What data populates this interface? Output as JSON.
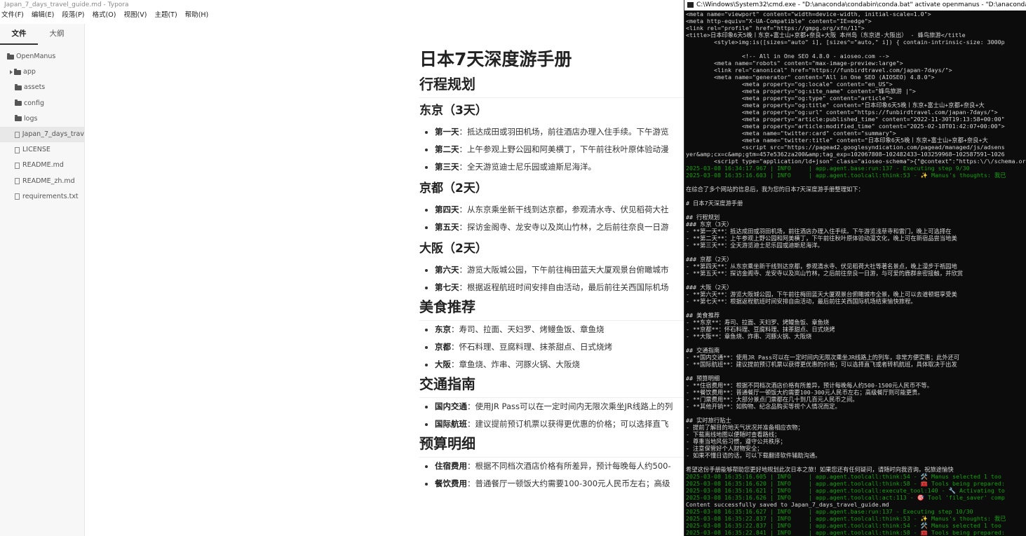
{
  "typora": {
    "title": "Japan_7_days_travel_guide.md - Typora",
    "menu": [
      "文件(F)",
      "编辑(E)",
      "段落(P)",
      "格式(O)",
      "视图(V)",
      "主题(T)",
      "帮助(H)"
    ],
    "sidebar_tabs": [
      "文件",
      "大纲"
    ],
    "tree": [
      {
        "label": "OpenManus",
        "type": "folder"
      },
      {
        "label": "app",
        "type": "folder-collapsed"
      },
      {
        "label": "assets",
        "type": "folder"
      },
      {
        "label": "config",
        "type": "folder"
      },
      {
        "label": "logs",
        "type": "folder"
      },
      {
        "label": "Japan_7_days_trav",
        "type": "file"
      },
      {
        "label": "LICENSE",
        "type": "file"
      },
      {
        "label": "README.md",
        "type": "file"
      },
      {
        "label": "README_zh.md",
        "type": "file"
      },
      {
        "label": "requirements.txt",
        "type": "file"
      }
    ],
    "doc": {
      "h1": "日本7天深度游手册",
      "itinerary_h": "行程规划",
      "tokyo_h": "东京（3天）",
      "tokyo": [
        {
          "k": "第一天",
          "v": "：抵达成田或羽田机场，前往酒店办理入住手续。下午游览"
        },
        {
          "k": "第二天",
          "v": "：上午参观上野公园和阿美横丁，下午前往秋叶原体验动漫"
        },
        {
          "k": "第三天",
          "v": "：全天游览迪士尼乐园或迪斯尼海洋。"
        }
      ],
      "kyoto_h": "京都（2天）",
      "kyoto": [
        {
          "k": "第四天",
          "v": "：从东京乘坐新干线到达京都，参观清水寺、伏见稻荷大社"
        },
        {
          "k": "第五天",
          "v": "：探访金阁寺、龙安寺以及岚山竹林，之后前往奈良一日游"
        }
      ],
      "osaka_h": "大阪（2天）",
      "osaka": [
        {
          "k": "第六天",
          "v": "：游览大阪城公园，下午前往梅田蓝天大厦观景台俯瞰城市"
        },
        {
          "k": "第七天",
          "v": "：根据返程航班时间安排自由活动，最后前往关西国际机场"
        }
      ],
      "food_h": "美食推荐",
      "food": [
        {
          "k": "东京",
          "v": "：寿司、拉面、天妇罗、烤鳗鱼饭、章鱼烧"
        },
        {
          "k": "京都",
          "v": "：怀石料理、豆腐料理、抹茶甜点、日式烧烤"
        },
        {
          "k": "大阪",
          "v": "：章鱼烧、炸串、河豚火锅、大阪烧"
        }
      ],
      "transport_h": "交通指南",
      "transport": [
        {
          "k": "国内交通",
          "v": "：使用JR Pass可以在一定时间内无限次乘坐JR线路上的列"
        },
        {
          "k": "国际航班",
          "v": "：建议提前预订机票以获得更优惠的价格；可以选择直飞"
        }
      ],
      "budget_h": "预算明细",
      "budget": [
        {
          "k": "住宿费用",
          "v": "：根据不同档次酒店价格有所差异，预计每晚每人约500-"
        },
        {
          "k": "餐饮费用",
          "v": "：普通餐厅一顿饭大约需要100-300元人民币左右；高级"
        }
      ]
    }
  },
  "console": {
    "title": "C:\\Windows\\System32\\cmd.exe - \"D:\\anaconda\\condabin\\conda.bat\"  activate openmanus - \"D:\\anaconda",
    "lines": [
      {
        "t": "<meta name=\"viewport\" content=\"width=device-width, initial-scale=1.0\">",
        "c": ""
      },
      {
        "t": "<meta http-equiv=\"X-UA-Compatible\" content=\"IE=edge\">",
        "c": ""
      },
      {
        "t": "<link rel=\"profile\" href=\"https://gmpg.org/xfn/11\">",
        "c": ""
      },
      {
        "t": "<title>日本印象6天5晚丨东京+富士山+京都+奈良+大阪 本州岛（东京进-大阪出） - 蜂鸟旅游</title",
        "c": ""
      },
      {
        "t": "        <style>img:is([sizes=\"auto\" i], [sizes^=\"auto,\" i]) { contain-intrinsic-size: 3000p",
        "c": ""
      },
      {
        "t": "",
        "c": ""
      },
      {
        "t": "                <!-- All in One SEO 4.8.0 - aioseo.com -->",
        "c": ""
      },
      {
        "t": "        <meta name=\"robots\" content=\"max-image-preview:large\">",
        "c": ""
      },
      {
        "t": "        <link rel=\"canonical\" href=\"https://funbirdtravel.com/japan-7days/\">",
        "c": ""
      },
      {
        "t": "        <meta name=\"generator\" content=\"All in One SEO (AIOSEO) 4.8.0\">",
        "c": ""
      },
      {
        "t": "                <meta property=\"og:locale\" content=\"en_US\">",
        "c": ""
      },
      {
        "t": "                <meta property=\"og:site_name\" content=\"蜂鸟旅游 |\">",
        "c": ""
      },
      {
        "t": "                <meta property=\"og:type\" content=\"article\">",
        "c": ""
      },
      {
        "t": "                <meta property=\"og:title\" content=\"日本印象6天5晚丨东京+富士山+京都+奈良+大",
        "c": ""
      },
      {
        "t": "                <meta property=\"og:url\" content=\"https://funbirdtravel.com/japan-7days/\">",
        "c": ""
      },
      {
        "t": "                <meta property=\"article:published_time\" content=\"2022-11-30T19:13:58+00:00\"",
        "c": ""
      },
      {
        "t": "                <meta property=\"article:modified_time\" content=\"2025-02-18T01:42:07+00:00\">",
        "c": ""
      },
      {
        "t": "                <meta name=\"twitter:card\" content=\"summary\">",
        "c": ""
      },
      {
        "t": "                <meta name=\"twitter:title\" content=\"日本印象6天5晚丨东京+富士山+京都+奈良+大",
        "c": ""
      },
      {
        "t": "                <script src=\"https://pagead2.googlesyndication.com/pagead/managed/js/adsens",
        "c": ""
      },
      {
        "t": "yer&amp;cx=c&amp;gtm=457e5362za200&amp;tag_exp=102067808~102482433~103259968~102587591~1026",
        "c": ""
      },
      {
        "t": "        <script type=\"application/ld+json\" class=\"aioseo-schema\">{\"@context\":\"https:\\/\\/schema.org\",\"@graph\":[{\"@type\":\"Breadcrumbl",
        "c": ""
      },
      {
        "t": "2025-03-08 16:34:17.967 | INFO     | app.agent.base:run:137 - Executing step 9/30",
        "c": "log"
      },
      {
        "t": "2025-03-08 16:35:16.603 | INFO     | app.agent.toolcall:think:53 - ✨ Manus's thoughts: 我已",
        "c": "log"
      },
      {
        "t": "",
        "c": ""
      },
      {
        "t": "在综合了多个网站的信息后，我为您的日本7天深度游手册整理如下：",
        "c": ""
      },
      {
        "t": "",
        "c": ""
      },
      {
        "t": "# 日本7天深度游手册",
        "c": ""
      },
      {
        "t": "",
        "c": ""
      },
      {
        "t": "## 行程规划",
        "c": ""
      },
      {
        "t": "### 东京（3天）",
        "c": ""
      },
      {
        "t": "- **第一天**：抵达成田或羽田机场，前往酒店办理入住手续。下午游览浅草寺和雷门，晚上可选择在",
        "c": ""
      },
      {
        "t": "- **第二天**：上午参观上野公园和阿美横丁，下午前往秋叶原体验动漫文化，晚上可在新宿品尝当地美",
        "c": ""
      },
      {
        "t": "- **第三天**：全天游览迪士尼乐园或迪斯尼海洋。",
        "c": ""
      },
      {
        "t": "",
        "c": ""
      },
      {
        "t": "### 京都（2天）",
        "c": ""
      },
      {
        "t": "- **第四天**：从东京乘坐新干线到达京都，参观清水寺、伏见稻荷大社等著名景点，晚上漫步于祇园地",
        "c": ""
      },
      {
        "t": "- **第五天**：探访金阁寺、龙安寺以及岚山竹林，之后前往奈良一日游，与可爱的鹿群亲密接触，并欣赏",
        "c": ""
      },
      {
        "t": "",
        "c": ""
      },
      {
        "t": "### 大阪（2天）",
        "c": ""
      },
      {
        "t": "- **第六天**：游览大阪城公园，下午前往梅田蓝天大厦观景台俯瞰城市全景，晚上可以去道顿堀享受美",
        "c": ""
      },
      {
        "t": "- **第七天**：根据返程航班时间安排自由活动，最后前往关西国际机场结束愉快旅程。",
        "c": ""
      },
      {
        "t": "",
        "c": ""
      },
      {
        "t": "## 美食推荐",
        "c": ""
      },
      {
        "t": "- **东京**：寿司、拉面、天妇罗、烤鳗鱼饭、章鱼烧",
        "c": ""
      },
      {
        "t": "- **京都**：怀石料理、豆腐料理、抹茶甜点、日式烧烤",
        "c": ""
      },
      {
        "t": "- **大阪**：章鱼烧、炸串、河豚火锅、大阪烧",
        "c": ""
      },
      {
        "t": "",
        "c": ""
      },
      {
        "t": "## 交通指南",
        "c": ""
      },
      {
        "t": "- **国内交通**：使用JR Pass可以在一定时间内无限次乘坐JR线路上的列车，非常方便实惠；此外还可",
        "c": ""
      },
      {
        "t": "- **国际航班**：建议提前预订机票以获得更优惠的价格；可以选择直飞或者转机航班，具体取决于出发",
        "c": ""
      },
      {
        "t": "",
        "c": ""
      },
      {
        "t": "## 预算明细",
        "c": ""
      },
      {
        "t": "- **住宿费用**：根据不同档次酒店价格有所差异，预计每晚每人约500-1500元人民币不等。",
        "c": ""
      },
      {
        "t": "- **餐饮费用**：普通餐厅一顿饭大约需要100-300元人民币左右；高级餐厅则可能更贵。",
        "c": ""
      },
      {
        "t": "- **门票费用**：大部分景点门票都在几十到几百元人民币之间。",
        "c": ""
      },
      {
        "t": "- **其他开销**：如购物、纪念品购买等视个人情况而定。",
        "c": ""
      },
      {
        "t": "",
        "c": ""
      },
      {
        "t": "## 实时旅行贴士",
        "c": ""
      },
      {
        "t": "- 提前了解目的地天气状况并准备相应衣物；",
        "c": ""
      },
      {
        "t": "- 下载离线地图以便随时查看路线；",
        "c": ""
      },
      {
        "t": "- 尊重当地风俗习惯，遵守公共秩序；",
        "c": ""
      },
      {
        "t": "- 注意保管好个人财物安全；",
        "c": ""
      },
      {
        "t": "- 如果不懂日语的话，可以下载翻译软件辅助沟通。",
        "c": ""
      },
      {
        "t": "",
        "c": ""
      },
      {
        "t": "希望这份手册能够帮助您更好地规划此次日本之旅！如果您还有任何疑问，请随时向我咨询。祝旅途愉快",
        "c": ""
      },
      {
        "t": "2025-03-08 16:35:16.605 | INFO     | app.agent.toolcall:think:54 - 🛠️ Manus selected 1 too",
        "c": "log"
      },
      {
        "t": "2025-03-08 16:35:16.620 | INFO     | app.agent.toolcall:think:58 - 🧰 Tools being prepared:",
        "c": "log"
      },
      {
        "t": "2025-03-08 16:35:16.621 | INFO     | app.agent.toolcall:execute_tool:140 - 🔧 Activating to",
        "c": "log"
      },
      {
        "t": "2025-03-08 16:35:16.626 | INFO     | app.agent.toolcall:act:113 - 🎯 Tool 'file_saver' comp",
        "c": "log"
      },
      {
        "t": "Content successfully saved to Japan_7_days_travel_guide.md",
        "c": ""
      },
      {
        "t": "2025-03-08 16:35:16.627 | INFO     | app.agent.base:run:137 - Executing step 10/30",
        "c": "log"
      },
      {
        "t": "2025-03-08 16:35:22.837 | INFO     | app.agent.toolcall:think:53 - ✨ Manus's thoughts: 我已",
        "c": "log"
      },
      {
        "t": "2025-03-08 16:35:22.837 | INFO     | app.agent.toolcall:think:54 - 🛠️ Manus selected 1 too",
        "c": "log"
      },
      {
        "t": "2025-03-08 16:35:22.841 | INFO     | app.agent.toolcall:think:58 - 🧰 Tools being prepared:",
        "c": "log"
      }
    ]
  }
}
